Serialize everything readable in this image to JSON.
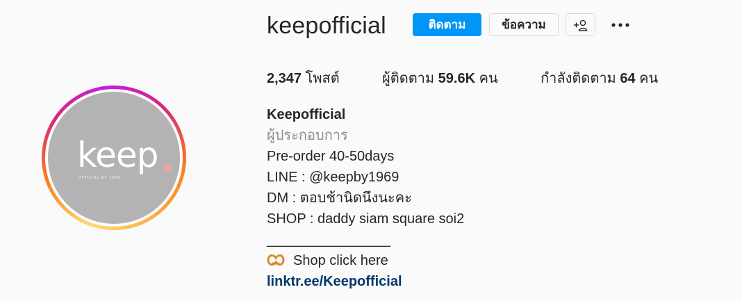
{
  "profile": {
    "username": "keepofficial",
    "follow_label": "ติดตาม",
    "message_label": "ข้อความ",
    "suggest_icon": "add-person-icon",
    "more_icon": "more-options-icon"
  },
  "stats": {
    "posts_count": "2,347",
    "posts_label": "โพสต์",
    "followers_label": "ผู้ติดตาม",
    "followers_count": "59.6K",
    "followers_unit": "คน",
    "following_label": "กำลังติดตาม",
    "following_count": "64",
    "following_unit": "คน"
  },
  "avatar": {
    "logo_text": "keep",
    "logo_subtext": "OFFICIAL BY 1969",
    "background_color": "#b3b3b3",
    "dot_color": "#f2a49a"
  },
  "bio": {
    "display_name": "Keepofficial",
    "category": "ผู้ประกอบการ",
    "lines": [
      "Pre-order 40-50days",
      "LINE : @keepby1969",
      "DM : ตอบช้านิดนึงนะคะ",
      "SHOP : daddy siam square soi2",
      "________________"
    ],
    "shop_emoji": "pretzel-icon",
    "shop_text": "Shop click here",
    "link_text": "linktr.ee/Keepofficial"
  },
  "colors": {
    "accent": "#0095f6",
    "link": "#00376b",
    "text": "#262626",
    "muted": "#8e8e8e"
  }
}
